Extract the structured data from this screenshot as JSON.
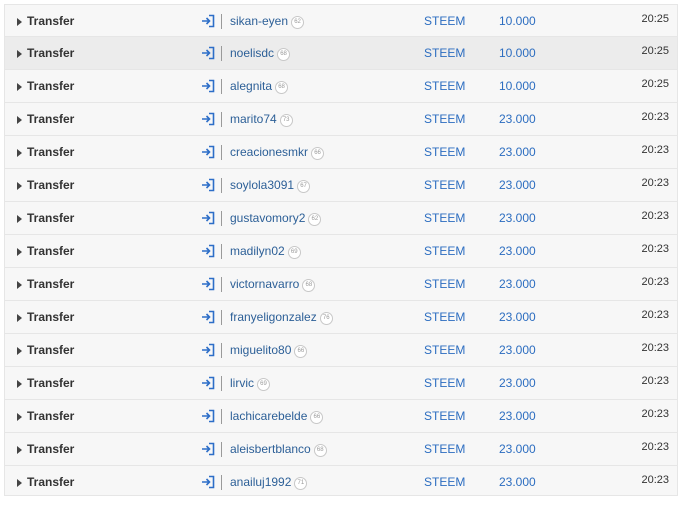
{
  "colors": {
    "row_bg": "#f7f7f7",
    "row_highlight_bg": "#ececec",
    "link": "#2c5f97",
    "value": "#2c6dc0",
    "icon": "#2d6ec8"
  },
  "icons": {
    "expand": "caret-right-icon",
    "direction": "sign-in-icon"
  },
  "transactions": [
    {
      "op": "Transfer",
      "account": "sikan-eyen",
      "rep": "62",
      "asset": "STEEM",
      "amount": "10.000",
      "time": "20:25"
    },
    {
      "op": "Transfer",
      "account": "noelisdc",
      "rep": "68",
      "asset": "STEEM",
      "amount": "10.000",
      "time": "20:25"
    },
    {
      "op": "Transfer",
      "account": "alegnita",
      "rep": "68",
      "asset": "STEEM",
      "amount": "10.000",
      "time": "20:25"
    },
    {
      "op": "Transfer",
      "account": "marito74",
      "rep": "73",
      "asset": "STEEM",
      "amount": "23.000",
      "time": "20:23"
    },
    {
      "op": "Transfer",
      "account": "creacionesmkr",
      "rep": "66",
      "asset": "STEEM",
      "amount": "23.000",
      "time": "20:23"
    },
    {
      "op": "Transfer",
      "account": "soylola3091",
      "rep": "67",
      "asset": "STEEM",
      "amount": "23.000",
      "time": "20:23"
    },
    {
      "op": "Transfer",
      "account": "gustavomory2",
      "rep": "62",
      "asset": "STEEM",
      "amount": "23.000",
      "time": "20:23"
    },
    {
      "op": "Transfer",
      "account": "madilyn02",
      "rep": "69",
      "asset": "STEEM",
      "amount": "23.000",
      "time": "20:23"
    },
    {
      "op": "Transfer",
      "account": "victornavarro",
      "rep": "68",
      "asset": "STEEM",
      "amount": "23.000",
      "time": "20:23"
    },
    {
      "op": "Transfer",
      "account": "franyeligonzalez",
      "rep": "76",
      "asset": "STEEM",
      "amount": "23.000",
      "time": "20:23"
    },
    {
      "op": "Transfer",
      "account": "miguelito80",
      "rep": "66",
      "asset": "STEEM",
      "amount": "23.000",
      "time": "20:23"
    },
    {
      "op": "Transfer",
      "account": "lirvic",
      "rep": "69",
      "asset": "STEEM",
      "amount": "23.000",
      "time": "20:23"
    },
    {
      "op": "Transfer",
      "account": "lachicarebelde",
      "rep": "66",
      "asset": "STEEM",
      "amount": "23.000",
      "time": "20:23"
    },
    {
      "op": "Transfer",
      "account": "aleisbertblanco",
      "rep": "68",
      "asset": "STEEM",
      "amount": "23.000",
      "time": "20:23"
    },
    {
      "op": "Transfer",
      "account": "anailuj1992",
      "rep": "71",
      "asset": "STEEM",
      "amount": "23.000",
      "time": "20:23"
    }
  ]
}
